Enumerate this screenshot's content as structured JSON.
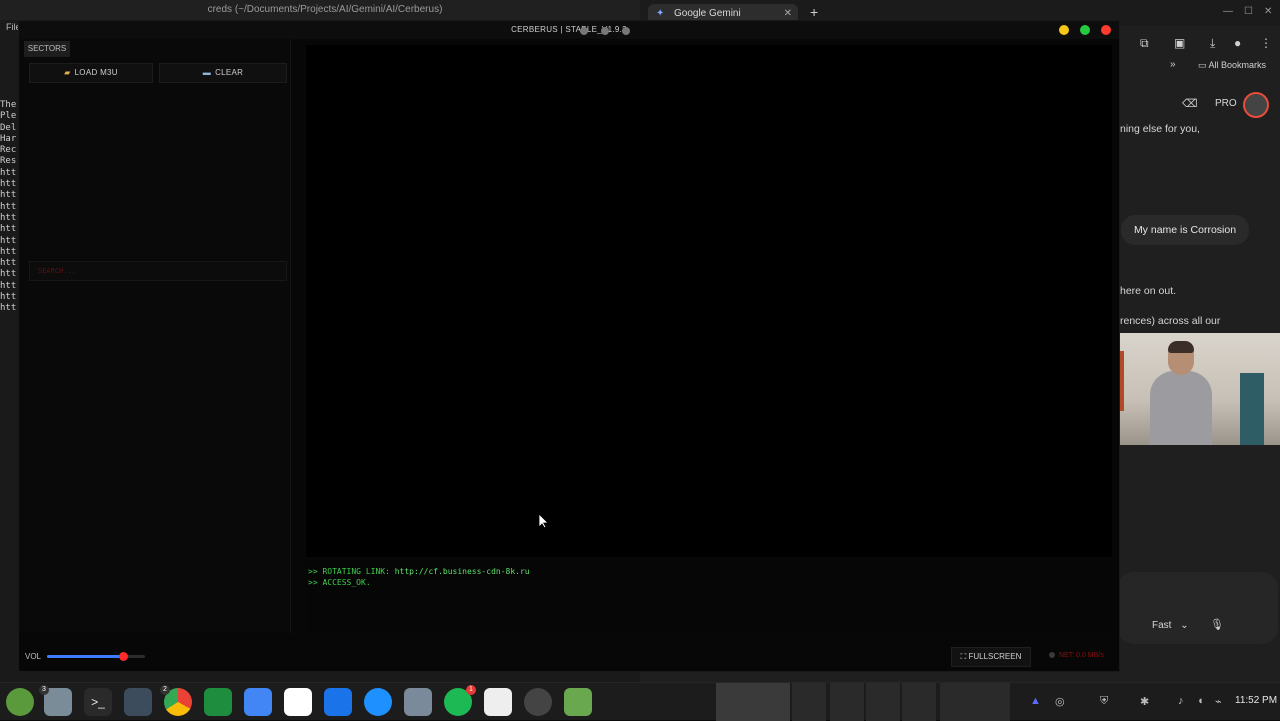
{
  "bg_editor": {
    "title": "creds (~/Documents/Projects/AI/Gemini/AI/Cerberus)",
    "file_menu": "File",
    "gutter_lines": [
      "The",
      "Ple",
      "Del",
      "Har",
      "Rec",
      "Res",
      "htt",
      "htt",
      "htt",
      "htt",
      "htt",
      "htt",
      "htt",
      "htt",
      "htt",
      "htt",
      "htt",
      "htt",
      "htt"
    ]
  },
  "bg_browser": {
    "tab_title": "Google Gemini",
    "bookmarks_label": "All Bookmarks",
    "pro_label": "PRO",
    "chat_lines": [
      {
        "text": "ning else for you,"
      },
      {
        "text": "here on out."
      },
      {
        "text": "rences) across all our"
      }
    ],
    "user_bubble": "My name is Corrosion",
    "model_select": "Fast"
  },
  "app": {
    "title": "CERBERUS | STABLE_V1.9.3",
    "sidebar": {
      "tab_label": "SECTORS",
      "load_button": "LOAD M3U",
      "clear_button": "CLEAR",
      "search_placeholder": "SEARCH..."
    },
    "console": {
      "lines": [
        {
          "prompt": ">>",
          "text": "ROTATING LINK:",
          "url": "http://cf.business-cdn-8k.ru"
        },
        {
          "prompt": ">>",
          "text": "ACCESS_OK.",
          "url": ""
        }
      ]
    },
    "bottom_bar": {
      "vol_label": "VOL",
      "volume": 0.78,
      "fullscreen_label": "FULLSCREEN",
      "net_status": "NET: 0.0 MB/s"
    }
  },
  "taskbar": {
    "clock": "11:52 PM",
    "badges": {
      "files": "3",
      "chat": "2",
      "spotify": "1"
    }
  },
  "colors": {
    "accent_green": "#3fd04a",
    "volume_blue": "#3d7cff",
    "volume_thumb": "#ff2a2a",
    "error_red": "#8c0f0f"
  }
}
